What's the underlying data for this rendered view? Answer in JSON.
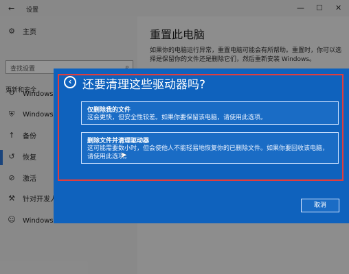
{
  "window": {
    "title": "设置"
  },
  "sidebar": {
    "home_label": "主页",
    "search_placeholder": "查找设置",
    "section_label": "更新和安全",
    "items": [
      {
        "label": "Windows 更"
      },
      {
        "label": "Windows D"
      },
      {
        "label": "备份"
      },
      {
        "label": "恢复"
      },
      {
        "label": "激活"
      },
      {
        "label": "针对开发人"
      },
      {
        "label": "Windows 预"
      }
    ]
  },
  "main": {
    "title": "重置此电脑",
    "description": "如果你的电脑运行异常，重置电脑可能会有所帮助。重置时，你可以选择是保留你的文件还是删除它们，然后重新安装 Windows。"
  },
  "dialog": {
    "title": "还要清理这些驱动器吗?",
    "option1": {
      "title": "仅删除我的文件",
      "description": "这会更快，但安全性较差。如果你要保留该电脑，请使用此选项。"
    },
    "option2": {
      "title": "删除文件并清理驱动器",
      "description": "这可能需要数小时，但会使他人不能轻易地恢复你的已删除文件。如果你要回收该电脑，请使用此选项。"
    },
    "cancel_label": "取消"
  },
  "colors": {
    "dialog_bg": "#0f62bd",
    "highlight_frame": "#e13d3d",
    "selected_bar": "#2a6fc9"
  }
}
